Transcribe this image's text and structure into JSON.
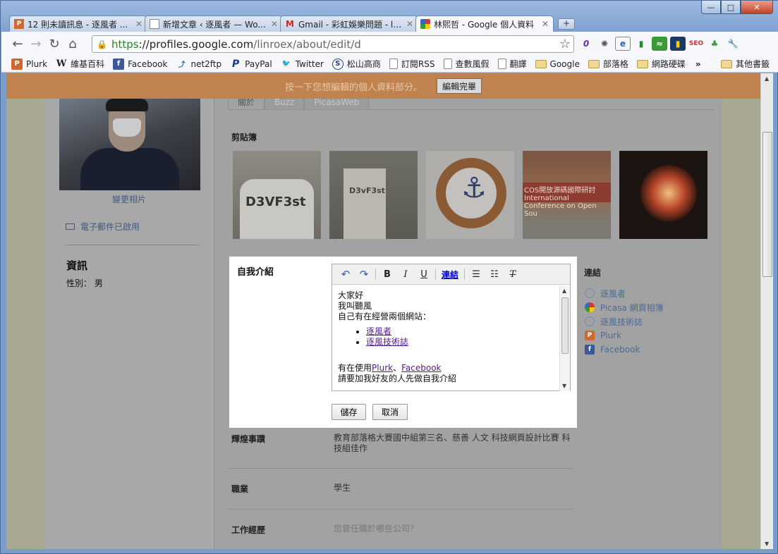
{
  "browser": {
    "tabs": [
      {
        "label": "12 則未讀訊息 - 逐風者 ...",
        "icon": "plurk-icon",
        "active": false
      },
      {
        "label": "新增文章 ‹ 逐風者 — Wo...",
        "icon": "page-icon",
        "active": false
      },
      {
        "label": "Gmail - 彩虹娛樂問題 - li...",
        "icon": "gmail-icon",
        "active": false
      },
      {
        "label": "林熙哲 - Google 個人資料",
        "icon": "google-icon",
        "active": true
      }
    ],
    "url_scheme": "https",
    "url_host": "://profiles.google.com",
    "url_path": "/linroex/about/edit/d",
    "bookmarks": [
      {
        "label": "Plurk",
        "icon": "plurk-icon"
      },
      {
        "label": "維基百科",
        "icon": "wikipedia-icon"
      },
      {
        "label": "Facebook",
        "icon": "facebook-icon"
      },
      {
        "label": "net2ftp",
        "icon": "net2ftp-icon"
      },
      {
        "label": "PayPal",
        "icon": "paypal-icon"
      },
      {
        "label": "Twitter",
        "icon": "twitter-icon"
      },
      {
        "label": "松山高商",
        "icon": "school-icon"
      },
      {
        "label": "訂閱RSS",
        "icon": "page-icon"
      },
      {
        "label": "查數風假",
        "icon": "page-icon"
      },
      {
        "label": "翻譯",
        "icon": "page-icon"
      },
      {
        "label": "Google",
        "icon": "folder-icon"
      },
      {
        "label": "部落格",
        "icon": "folder-icon"
      },
      {
        "label": "網路硬碟",
        "icon": "folder-icon"
      }
    ],
    "bookmarks_more": "»",
    "other_bookmarks": "其他書籤"
  },
  "notice": {
    "text": "按一下您想編輯的個人資料部分。",
    "done_button": "編輯完畢"
  },
  "sidebar": {
    "change_photo": "變更相片",
    "email_status": "電子郵件已啟用",
    "info_heading": "資訊",
    "gender": "性別： 男"
  },
  "profile_tabs": [
    "關於",
    "Buzz",
    "PicasaWeb"
  ],
  "scrapbook": {
    "heading": "剪貼簿",
    "thumb1_text": "D3VF3st",
    "thumb2_text": "D3vF3st",
    "thumb4_text": "COS開放源碼國際研討 International Conference on Open Sou"
  },
  "editor": {
    "label": "自我介紹",
    "toolbar": {
      "bold": "B",
      "italic": "I",
      "underline": "U",
      "link": "連結"
    },
    "lines": [
      "大家好",
      "我叫聽風",
      "自己有在經營兩個網站："
    ],
    "list": [
      "逐風者",
      "逐風技術誌"
    ],
    "using_prefix": "有在使用",
    "using_link1": "Plurk",
    "using_sep": "、",
    "using_link2": "Facebook",
    "last_line": "請要加我好友的人先做自我介紹",
    "save": "儲存",
    "cancel": "取消"
  },
  "links": {
    "heading": "連結",
    "items": [
      {
        "label": "逐風者",
        "icon": "link-icon"
      },
      {
        "label": "Picasa 網頁相簿",
        "icon": "picasa-icon"
      },
      {
        "label": "逐風技術誌",
        "icon": "link-icon"
      },
      {
        "label": "Plurk",
        "icon": "plurk-icon"
      },
      {
        "label": "Facebook",
        "icon": "facebook-icon"
      }
    ]
  },
  "fields": {
    "achievements_label": "輝煌事蹟",
    "achievements_value": "教育部落格大賽國中組第三名、慈善 人文 科技網頁設計比賽 科技組佳作",
    "occupation_label": "職業",
    "occupation_value": "學生",
    "work_label": "工作經歷",
    "work_value": "您曾任職於哪些公司？"
  }
}
